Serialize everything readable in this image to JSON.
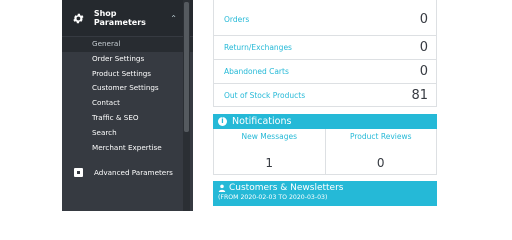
{
  "sidebar": {
    "section_title": "Shop Parameters",
    "items": [
      {
        "label": "General"
      },
      {
        "label": "Order Settings"
      },
      {
        "label": "Product Settings"
      },
      {
        "label": "Customer Settings"
      },
      {
        "label": "Contact"
      },
      {
        "label": "Traffic & SEO"
      },
      {
        "label": "Search"
      },
      {
        "label": "Merchant Expertise"
      }
    ],
    "advanced_label": "Advanced Parameters"
  },
  "stats": [
    {
      "label": "Orders",
      "value": "0"
    },
    {
      "label": "Return/Exchanges",
      "value": "0"
    },
    {
      "label": "Abandoned Carts",
      "value": "0"
    },
    {
      "label": "Out of Stock Products",
      "value": "81"
    }
  ],
  "notifications": {
    "title": "Notifications",
    "new_messages_label": "New Messages",
    "new_messages_value": "1",
    "product_reviews_label": "Product Reviews",
    "product_reviews_value": "0"
  },
  "customers": {
    "title": "Customers & Newsletters",
    "range": "(FROM 2020-02-03 TO 2020-03-03)"
  },
  "colors": {
    "accent": "#25b9d7",
    "sidebar_bg": "#363a41",
    "sidebar_header_bg": "#25292e"
  }
}
